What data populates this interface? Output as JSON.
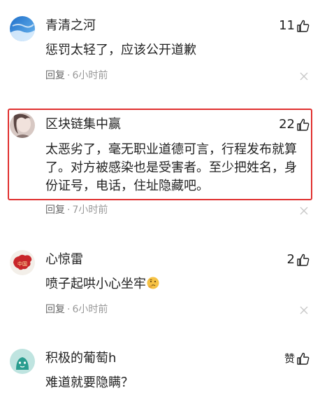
{
  "comments": [
    {
      "username": "青清之河",
      "likes": "11",
      "text": "惩罚太轻了，应该公开道歉",
      "reply_label": "回复",
      "time": "6小时前",
      "avatar_icon": "blue-sky-avatar"
    },
    {
      "username": "区块链集中赢",
      "likes": "22",
      "text": "太恶劣了，毫无职业道德可言，行程发布就算了。对方被感染也是受害者。至少把姓名，身份证号，电话，住址隐藏吧。",
      "reply_label": "回复",
      "time": "7小时前",
      "avatar_icon": "portrait-avatar"
    },
    {
      "username": "心惊雷",
      "likes": "2",
      "text": "喷子起哄小心坐牢",
      "reply_label": "回复",
      "time": "6小时前",
      "avatar_icon": "china-map-avatar",
      "emoji_icon": "thinking-face-emoji"
    },
    {
      "username": "积极的葡萄h",
      "likes": "赞",
      "text": "难道就要隐瞒？",
      "avatar_icon": "teal-cartoon-avatar"
    }
  ],
  "separator": "·",
  "colors": {
    "highlight_border": "#e0302f",
    "meta_text": "#999999",
    "body_text": "#222222"
  }
}
